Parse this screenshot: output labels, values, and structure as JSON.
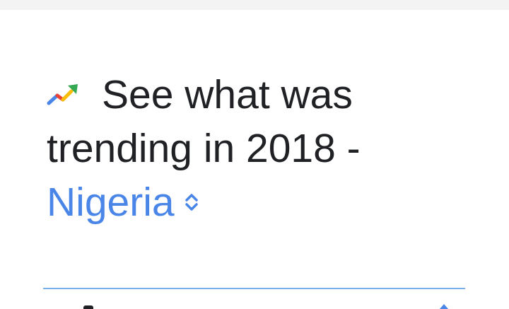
{
  "header": {
    "icon": "trending-up-icon",
    "title_line1": "See what was",
    "title_line2": "trending in 2018 -",
    "region": "Nigeria",
    "region_selector_icon": "unfold-chevrons-icon"
  },
  "colors": {
    "text": "#202124",
    "accent": "#4a86e8",
    "divider": "#7aaee8"
  }
}
